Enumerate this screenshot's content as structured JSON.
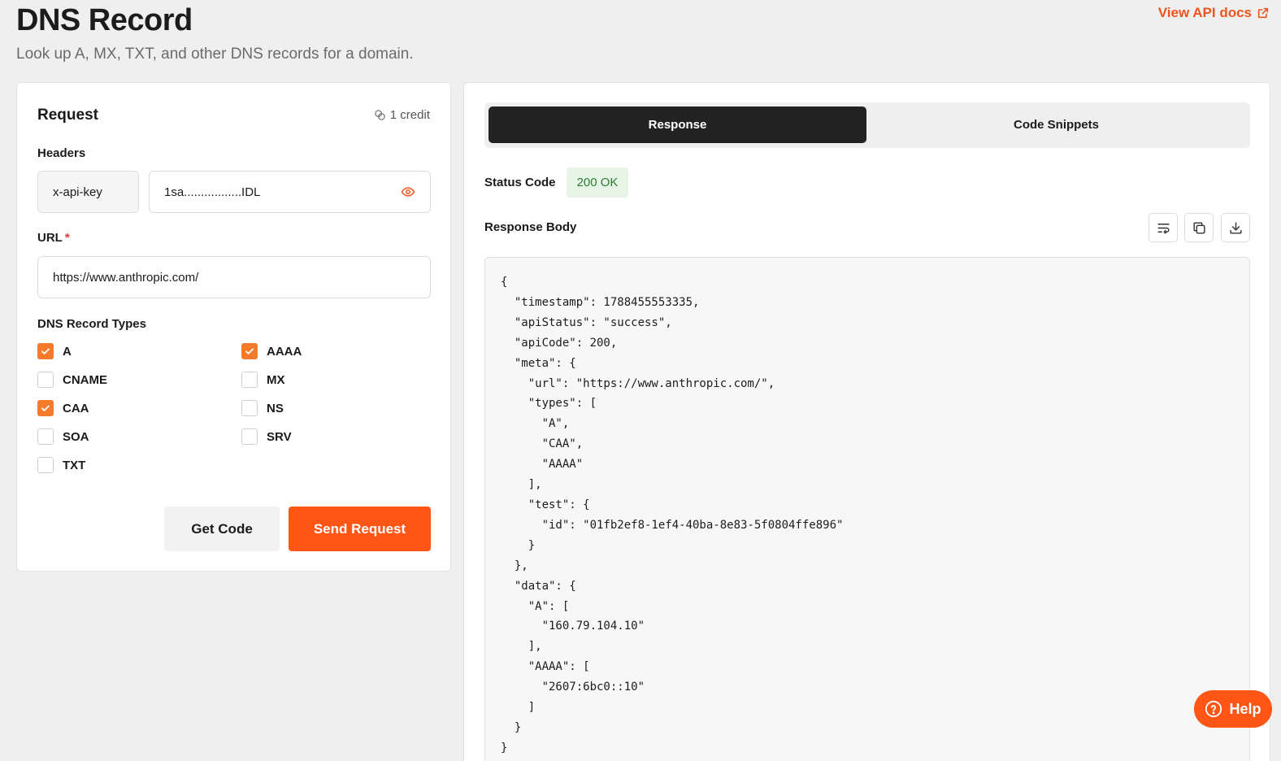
{
  "header": {
    "title": "DNS Record",
    "subtitle": "Look up A, MX, TXT, and other DNS records for a domain.",
    "api_docs_label": "View API docs",
    "api_docs_icon": "external-link-icon"
  },
  "request": {
    "title": "Request",
    "credit_label": "1 credit",
    "credit_icon": "coins-icon",
    "headers_label": "Headers",
    "header_key": "x-api-key",
    "header_value": "1sa.................IDL",
    "header_value_icon": "eye-icon",
    "url_label": "URL",
    "url_required": "*",
    "url_value": "https://www.anthropic.com/",
    "dns_types_label": "DNS Record Types",
    "record_types": [
      {
        "label": "A",
        "checked": true
      },
      {
        "label": "AAAA",
        "checked": true
      },
      {
        "label": "CNAME",
        "checked": false
      },
      {
        "label": "MX",
        "checked": false
      },
      {
        "label": "CAA",
        "checked": true
      },
      {
        "label": "NS",
        "checked": false
      },
      {
        "label": "SOA",
        "checked": false
      },
      {
        "label": "SRV",
        "checked": false
      },
      {
        "label": "TXT",
        "checked": false
      }
    ],
    "get_code_label": "Get Code",
    "send_request_label": "Send Request"
  },
  "response": {
    "tabs": [
      "Response",
      "Code Snippets"
    ],
    "active_tab": "Response",
    "status_label": "Status Code",
    "status_value": "200 OK",
    "body_label": "Response Body",
    "toolbar_icons": [
      "wrap-text-icon",
      "copy-icon",
      "download-icon"
    ],
    "body_text": "{\n  \"timestamp\": 1788455553335,\n  \"apiStatus\": \"success\",\n  \"apiCode\": 200,\n  \"meta\": {\n    \"url\": \"https://www.anthropic.com/\",\n    \"types\": [\n      \"A\",\n      \"CAA\",\n      \"AAAA\"\n    ],\n    \"test\": {\n      \"id\": \"01fb2ef8-1ef4-40ba-8e83-5f0804ffe896\"\n    }\n  },\n  \"data\": {\n    \"A\": [\n      \"160.79.104.10\"\n    ],\n    \"AAAA\": [\n      \"2607:6bc0::10\"\n    ]\n  }\n}"
  },
  "help": {
    "label": "Help",
    "icon": "question-circle-icon"
  },
  "colors": {
    "accent": "#ff5515",
    "checkbox": "#f47a2c",
    "link": "#f0541e",
    "status_bg": "#e6f5e6",
    "status_text": "#2e7d32",
    "active_tab_bg": "#222222"
  }
}
